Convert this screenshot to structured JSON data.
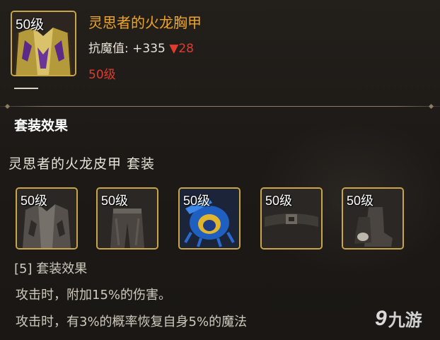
{
  "item": {
    "level_badge": "50级",
    "name": "灵思者的火龙胸甲",
    "stat_label": "抗魔值:",
    "stat_value": "+335",
    "stat_diff": "▼28",
    "required_level": "50级"
  },
  "set": {
    "header": "套装效果",
    "name": "灵思者的火龙皮甲  套装",
    "pieces": [
      {
        "level_badge": "50级",
        "icon": "jacket-icon"
      },
      {
        "level_badge": "50级",
        "icon": "pants-icon"
      },
      {
        "level_badge": "50级",
        "icon": "blue-shoulder-icon"
      },
      {
        "level_badge": "50级",
        "icon": "belt-icon"
      },
      {
        "level_badge": "50级",
        "icon": "boots-icon"
      }
    ],
    "bonus_title": "[5] 套装效果",
    "effects": [
      "攻击时，附加15%的伤害。",
      "攻击时，有3%的概率恢复自身5%的魔法"
    ]
  },
  "watermark": {
    "glyph": "9",
    "text": "九游"
  },
  "colors": {
    "gold_border": "#c9a64a",
    "item_name": "#f0a52a",
    "red": "#e03b2f",
    "background": "#1e1a17"
  }
}
